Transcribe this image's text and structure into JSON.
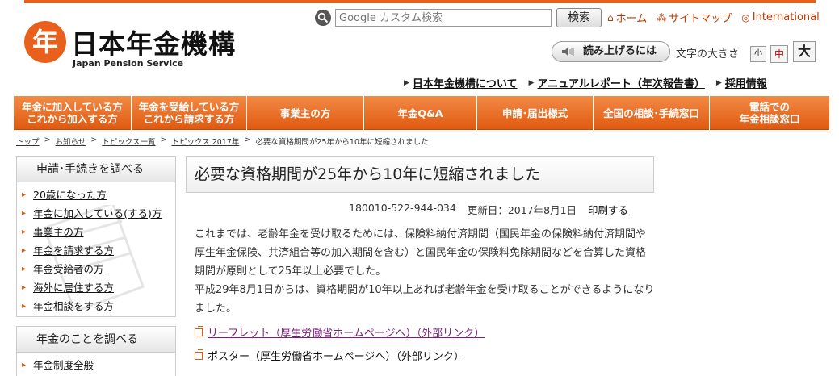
{
  "logo": {
    "mark": "年",
    "name_ja": "日本年金機構",
    "name_en": "Japan Pension Service"
  },
  "search": {
    "placeholder": "Google カスタム検索",
    "button": "検索"
  },
  "top_links": [
    {
      "icon": "⌂",
      "label": "ホーム"
    },
    {
      "icon": "⁂",
      "label": "サイトマップ"
    },
    {
      "icon": "◎",
      "label": "International"
    }
  ],
  "readaloud": {
    "label": "読み上げるには"
  },
  "font_size": {
    "label": "文字の大きさ",
    "small": "小",
    "medium": "中",
    "large": "大"
  },
  "sub_links": [
    {
      "label": "日本年金機構について"
    },
    {
      "label": "アニュアルレポート（年次報告書）"
    },
    {
      "label": "採用情報"
    }
  ],
  "gnav": [
    {
      "line1": "年金に加入している方",
      "line2": "これから加入する方"
    },
    {
      "line1": "年金を受給している方",
      "line2": "これから請求する方"
    },
    {
      "line1": "事業主の方",
      "line2": ""
    },
    {
      "line1": "年金Q&A",
      "line2": ""
    },
    {
      "line1": "申請･届出様式",
      "line2": ""
    },
    {
      "line1": "全国の相談･手続窓口",
      "line2": ""
    },
    {
      "line1": "電話での",
      "line2": "年金相談窓口"
    }
  ],
  "breadcrumb": [
    {
      "label": "トップ",
      "link": true
    },
    {
      "label": ">",
      "link": false
    },
    {
      "label": "お知らせ",
      "link": true
    },
    {
      "label": ">",
      "link": false
    },
    {
      "label": "トピックス一覧",
      "link": true
    },
    {
      "label": ">",
      "link": false
    },
    {
      "label": "トピックス 2017年",
      "link": true
    },
    {
      "label": ">",
      "link": false
    },
    {
      "label": "必要な資格期間が25年から10年に短縮されました",
      "link": false
    }
  ],
  "sidebar": {
    "box1": {
      "heading": "申請･手続きを調べる",
      "items": [
        "20歳になった方",
        "年金に加入している(する)方",
        "事業主の方",
        "年金を請求する方",
        "年金受給者の方",
        "海外に居住する方",
        "年金相談をする方"
      ]
    },
    "box2": {
      "heading": "年金のことを調べる",
      "items": [
        "年金制度全般"
      ]
    }
  },
  "article": {
    "title": "必要な資格期間が25年から10年に短縮されました",
    "id": "180010-522-944-034",
    "updated": "更新日：2017年8月1日",
    "print": "印刷する",
    "paragraph1": "これまでは、老齢年金を受け取るためには、保険料納付済期間（国民年金の保険料納付済期間や厚生年金保険、共済組合等の加入期間を含む）と国民年金の保険料免除期間などを合算した資格期間が原則として25年以上必要でした。",
    "paragraph2": "平成29年8月1日からは、資格期間が10年以上あれば老齢年金を受け取ることができるようになりました。",
    "links": [
      "リーフレット（厚生労働省ホームページへ）（外部リンク）",
      "ポスター（厚生労働省ホームページへ）（外部リンク）"
    ]
  },
  "colors": {
    "accent": "#e05a10",
    "visited_link": "#7a1f7a"
  }
}
